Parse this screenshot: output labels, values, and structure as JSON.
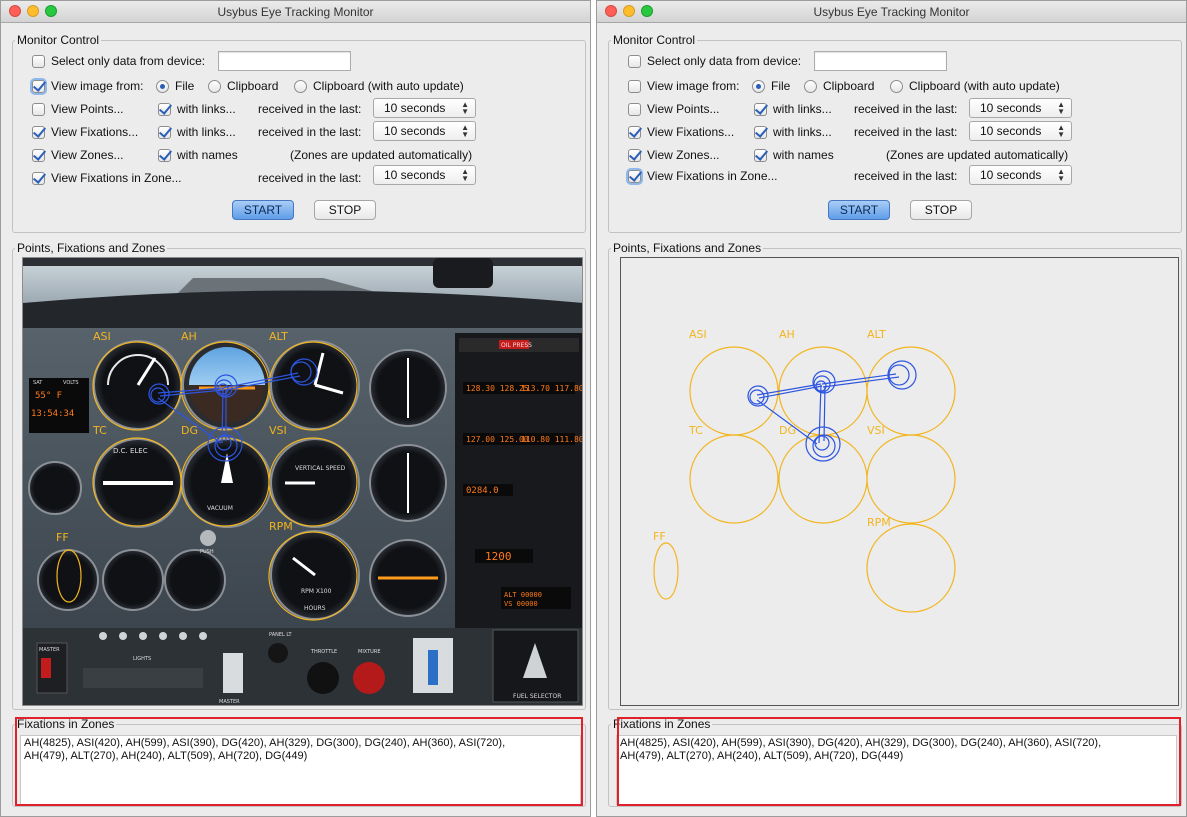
{
  "window_title": "Usybus Eye Tracking Monitor",
  "monitor_control": {
    "legend": "Monitor Control",
    "select_only_label": "Select only data from device:",
    "device_value": "",
    "view_image_label": "View image from:",
    "radio_file": "File",
    "radio_clipboard": "Clipboard",
    "radio_clipboard_auto": "Clipboard (with auto update)",
    "view_points_label": "View Points...",
    "view_fixations_label": "View Fixations...",
    "view_zones_label": "View Zones...",
    "view_fix_zone_label": "View Fixations in Zone...",
    "with_links_label": "with links...",
    "with_names_label": "with names",
    "received_label": "received in the last:",
    "zones_auto_note": "(Zones are updated automatically)",
    "seconds_value": "10 seconds",
    "start_label": "START",
    "stop_label": "STOP"
  },
  "points_panel": {
    "legend": "Points, Fixations and Zones"
  },
  "zones_panel": {
    "legend": "Fixations in Zones",
    "line1": "AH(4825), ASI(420), AH(599), ASI(390), DG(420), AH(329), DG(300), DG(240), AH(360), ASI(720),",
    "line2": "AH(479), ALT(270), AH(240), ALT(509), AH(720), DG(449)"
  },
  "zone_labels": {
    "asi": "ASI",
    "ah": "AH",
    "alt": "ALT",
    "tc": "TC",
    "dg": "DG",
    "vsi": "VSI",
    "ff": "FF",
    "rpm": "RPM"
  },
  "cockpit": {
    "oil_press": "OIL PRESS",
    "freq_left": "128.30 128.25",
    "freq_right": "113.70 117.80",
    "freq2_left": "127.00 125.00",
    "freq2_right": "110.80 111.80",
    "adf_readout": "0284.0",
    "transponder": "1200",
    "alt_readout": "ALT 00000",
    "vs_readout": "VS 00000",
    "temp_readout": "55° F",
    "time_readout": "13:54:34",
    "sat": "SAT",
    "volts": "VOLTS",
    "dc_elec": "D.C. ELEC",
    "vacuum": "VACUUM",
    "vertical_speed": "VERTICAL SPEED",
    "hours": "HOURS",
    "rpm_gauge": "RPM X100",
    "fuel_selector": "FUEL SELECTOR",
    "master": "MASTER",
    "throttle": "THROTTLE",
    "mixture": "MIXTURE",
    "panel_lt": "PANEL LT",
    "lights": "LIGHTS",
    "push": "PUSH"
  },
  "colors": {
    "zone": "#f2b51e",
    "fixation": "#2d55e0",
    "highlight": "#e0202a",
    "start_button": "#5f9de8"
  }
}
